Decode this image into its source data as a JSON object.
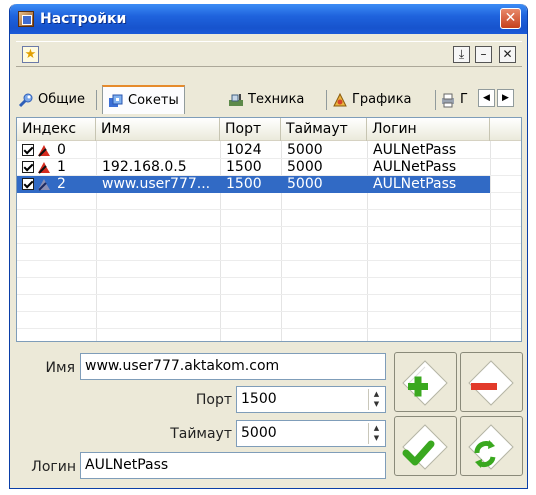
{
  "window": {
    "title": "Настройки",
    "close_glyph": "✕"
  },
  "toolbar": {
    "star_glyph": "★",
    "btn1_glyph": "⤓",
    "btn2_glyph": "–",
    "btn3_glyph": "✕"
  },
  "tabs": [
    {
      "label": "Общие",
      "icon": "wrench-icon"
    },
    {
      "label": "Сокеты",
      "icon": "sockets-icon",
      "active": true
    },
    {
      "label": "Техника",
      "icon": "hardware-icon"
    },
    {
      "label": "Графика",
      "icon": "graphics-icon"
    },
    {
      "label": "Г",
      "icon": "printer-icon"
    }
  ],
  "tab_scroll": {
    "left": "◀",
    "right": "▶"
  },
  "grid": {
    "columns": [
      "Индекс",
      "Имя",
      "Порт",
      "Таймаут",
      "Логин"
    ],
    "rows": [
      {
        "index": "0",
        "name": "",
        "port": "1024",
        "timeout": "5000",
        "login": "AULNetPass",
        "checked": true,
        "selected": false
      },
      {
        "index": "1",
        "name": "192.168.0.5",
        "port": "1500",
        "timeout": "5000",
        "login": "AULNetPass",
        "checked": true,
        "selected": false
      },
      {
        "index": "2",
        "name": "www.user777...",
        "port": "1500",
        "timeout": "5000",
        "login": "AULNetPass",
        "checked": true,
        "selected": true
      }
    ]
  },
  "form": {
    "name_label": "Имя",
    "name_value": "www.user777.aktakom.com",
    "port_label": "Порт",
    "port_value": "1500",
    "timeout_label": "Таймаут",
    "timeout_value": "5000",
    "login_label": "Логин",
    "login_value": "AULNetPass"
  },
  "colors": {
    "accent_green": "#3aa81f",
    "accent_red": "#e23a2a",
    "selection": "#316ac5"
  }
}
